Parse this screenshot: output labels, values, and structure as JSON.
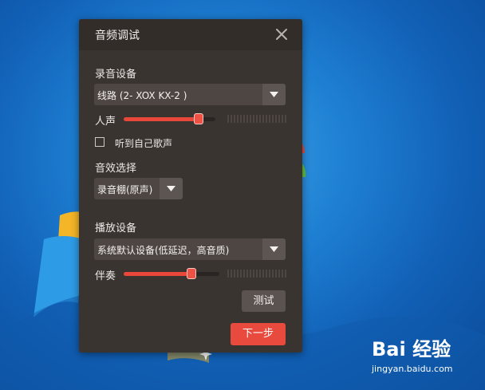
{
  "dialog": {
    "title": "音频调试",
    "close_icon": "close-icon",
    "recording": {
      "label": "录音设备",
      "device_value": "线路 (2- XOX KX-2 )",
      "vocal_label": "人声",
      "vocal_level": 0.82
    },
    "monitor_checkbox": {
      "label": "听到自己歌声",
      "checked": false
    },
    "effect": {
      "label": "音效选择",
      "value": "录音棚(原声)"
    },
    "playback": {
      "label": "播放设备",
      "device_value": "系统默认设备(低延迟，高音质)",
      "accomp_label": "伴奏",
      "accomp_level": 0.71
    },
    "test_button": "测试",
    "next_button": "下一步"
  },
  "watermark": {
    "brand": "Bai 经验",
    "url": "jingyan.baidu.com"
  },
  "colors": {
    "accent": "#e84a3d",
    "dialog_bg": "#3a3431",
    "desktop_blue": "#1e7fd2"
  }
}
